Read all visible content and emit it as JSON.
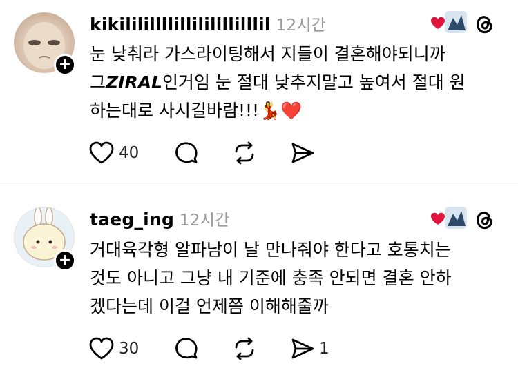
{
  "posts": [
    {
      "username": "kikililillllillilillllilllil",
      "time": "12시간",
      "lines": [
        "눈 낮춰라 가스라이팅해서 지들이 결혼해야되니까",
        "그ZIRAL인거임 눈 절대 낮추지말고 높여서 절대 원",
        "하는대로 사시길바람!!!💃❤️"
      ],
      "line2_prefix": "그",
      "line2_emph": "ZIRAL",
      "line2_suffix": "인거임 눈 절대 낮추지말고 높여서 절대 원",
      "line3_text": "하는대로 사시길바람!!!",
      "line3_emoji": "💃❤️",
      "likes": "40",
      "shares": ""
    },
    {
      "username": "taeg_ing",
      "time": "12시간",
      "lines": [
        "거대육각형 알파남이 날 만나줘야 한다고 호통치는",
        "것도 아니고 그냥 내 기준에 충족 안되면 결혼 안하",
        "겠다는데 이걸 언제쯤 이해해줄까"
      ],
      "likes": "30",
      "shares": "1"
    }
  ],
  "icons": {
    "like": "heart-outline-icon",
    "reply": "reply-bubble-icon",
    "repost": "repost-icon",
    "share": "send-icon",
    "threads": "threads-logo-icon",
    "follow": "plus-icon"
  },
  "colors": {
    "time": "#9b9b9b",
    "heart_badge": "#e0143c",
    "divider": "#dcdcdc"
  }
}
